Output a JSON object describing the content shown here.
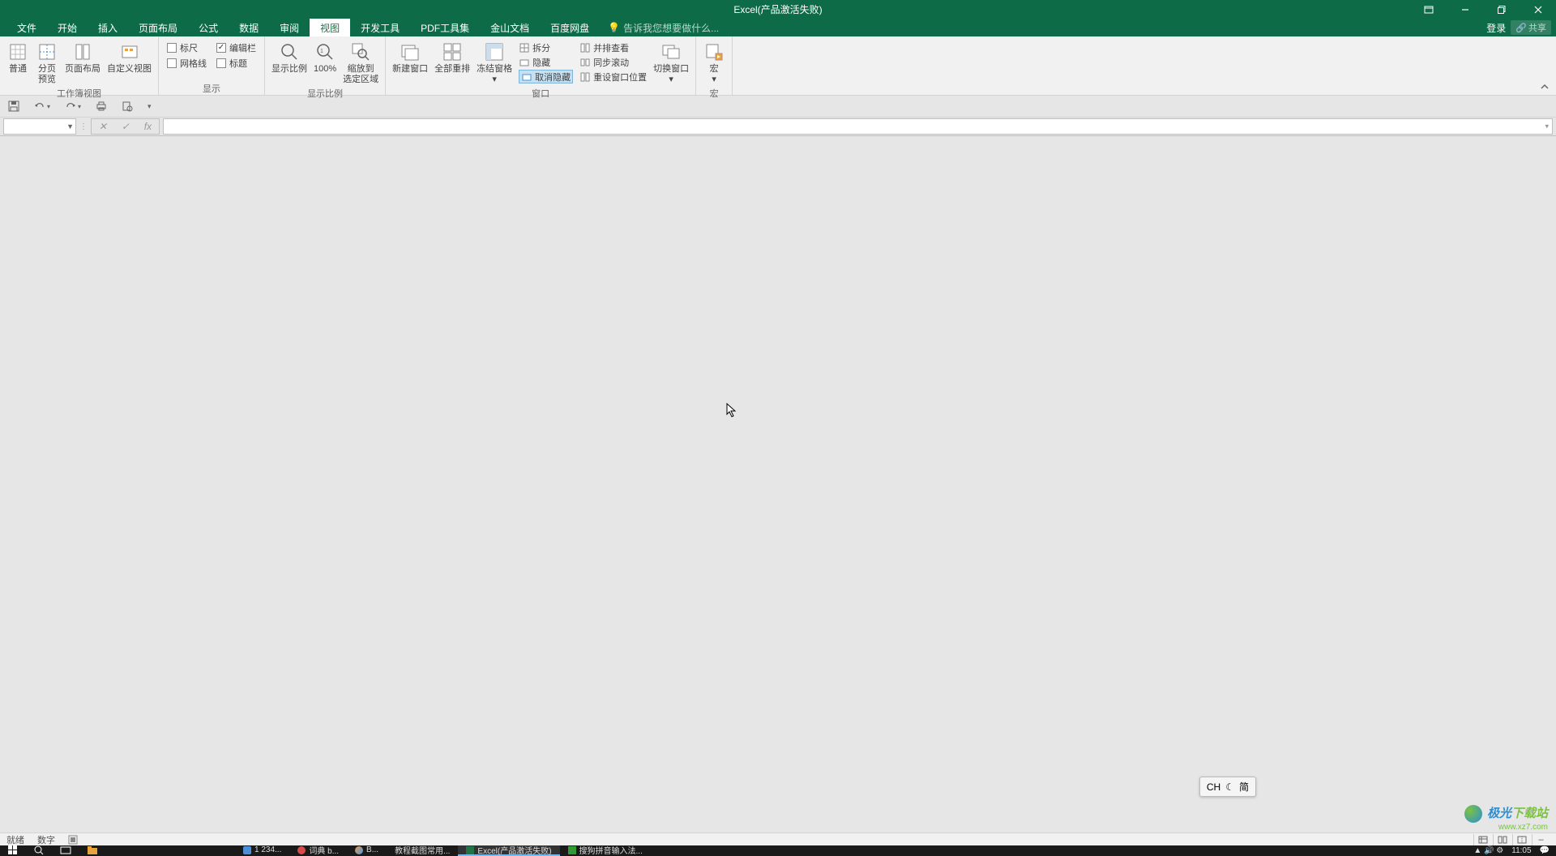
{
  "title": "Excel(产品激活失败)",
  "tabs": {
    "file": "文件",
    "home": "开始",
    "insert": "插入",
    "pagelayout": "页面布局",
    "formulas": "公式",
    "data": "数据",
    "review": "审阅",
    "view": "视图",
    "developer": "开发工具",
    "pdftools": "PDF工具集",
    "jinshan": "金山文档",
    "baidu": "百度网盘",
    "tellme": "告诉我您想要做什么...",
    "login": "登录",
    "share": "共享"
  },
  "ribbon": {
    "group_workbookviews": "工作簿视图",
    "group_show": "显示",
    "group_zoom": "显示比例",
    "group_window": "窗口",
    "group_macro": "宏",
    "btn_normal": "普通",
    "btn_pagebreak_l1": "分页",
    "btn_pagebreak_l2": "预览",
    "btn_pagelayout": "页面布局",
    "btn_customview": "自定义视图",
    "chk_ruler": "标尺",
    "chk_gridlines": "网格线",
    "chk_formulabar": "编辑栏",
    "chk_headings": "标题",
    "btn_zoom": "显示比例",
    "btn_100": "100%",
    "btn_zoomsel_l1": "缩放到",
    "btn_zoomsel_l2": "选定区域",
    "btn_newwin": "新建窗口",
    "btn_arrangeall": "全部重排",
    "btn_freeze": "冻结窗格",
    "btn_split": "拆分",
    "btn_hide": "隐藏",
    "btn_unhide": "取消隐藏",
    "btn_sidebyside": "并排查看",
    "btn_syncscroll": "同步滚动",
    "btn_resetpos": "重设窗口位置",
    "btn_switchwin": "切换窗口",
    "btn_macro": "宏"
  },
  "status": {
    "ready": "就绪",
    "num": "数字"
  },
  "ime": {
    "lang": "CH",
    "mode": "简"
  },
  "watermark": {
    "a": "极光",
    "b": "下载站",
    "url": "www.xz7.com"
  },
  "taskbar": {
    "t1": "1  234...",
    "t2": "词典 b...",
    "t3": "B...",
    "t4": "教程截图常用...",
    "t5": "Excel(产品激活失败)",
    "t6": "... ",
    "t7": "搜狗拼音输入法...",
    "time": "11:05"
  }
}
